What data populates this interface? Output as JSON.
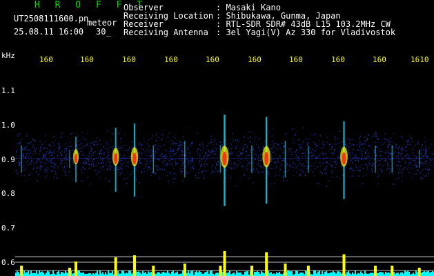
{
  "header": {
    "logo": "H R O F F T",
    "file_name": "UT2508111600.pn",
    "mode": "meteor",
    "datetime": "25.08.11 16:00",
    "interval": "30_"
  },
  "info": {
    "labels": [
      "Observer",
      "Receiving Location",
      "Receiver",
      "Receiving Antenna"
    ],
    "values": [
      ": Masaki Kano",
      ": Shibukawa, Gunma, Japan",
      ": RTL-SDR SDR# 43dB L15 103.2MHz CW",
      ": 3el Yagi(V) Az 330 for Vladivostok"
    ]
  },
  "axes": {
    "y_unit": "kHz",
    "y_ticks": [
      "1.1",
      "1.0",
      "0.9",
      "0.8",
      "0.7",
      "0.6"
    ],
    "x_ticks": [
      "160",
      "160",
      "160",
      "160",
      "160",
      "160",
      "160",
      "160",
      "160",
      "1610"
    ]
  },
  "colors": {
    "background": "#000000",
    "noise_band": "#1010a0",
    "echo_hot": "#ff2020",
    "echo_warm": "#ffff00",
    "echo_cool": "#20e0ff",
    "activity_yellow": "#ffff00",
    "activity_cyan": "#00ffff"
  },
  "chart_data": {
    "type": "heatmap",
    "x_label": "",
    "y_label": "kHz",
    "ylim": [
      0.58,
      1.15
    ],
    "noise_band_khz": [
      0.82,
      1.0
    ],
    "echo_columns": [
      {
        "x_frac": 0.015,
        "strength": 0.3
      },
      {
        "x_frac": 0.13,
        "strength": 0.2
      },
      {
        "x_frac": 0.145,
        "strength": 0.5
      },
      {
        "x_frac": 0.24,
        "strength": 0.7
      },
      {
        "x_frac": 0.285,
        "strength": 0.8
      },
      {
        "x_frac": 0.33,
        "strength": 0.3
      },
      {
        "x_frac": 0.405,
        "strength": 0.4
      },
      {
        "x_frac": 0.49,
        "strength": 0.3
      },
      {
        "x_frac": 0.5,
        "strength": 1.0
      },
      {
        "x_frac": 0.565,
        "strength": 0.3
      },
      {
        "x_frac": 0.6,
        "strength": 0.95
      },
      {
        "x_frac": 0.645,
        "strength": 0.4
      },
      {
        "x_frac": 0.7,
        "strength": 0.3
      },
      {
        "x_frac": 0.785,
        "strength": 0.85
      },
      {
        "x_frac": 0.86,
        "strength": 0.3
      },
      {
        "x_frac": 0.9,
        "strength": 0.3
      },
      {
        "x_frac": 0.965,
        "strength": 0.2
      }
    ]
  }
}
